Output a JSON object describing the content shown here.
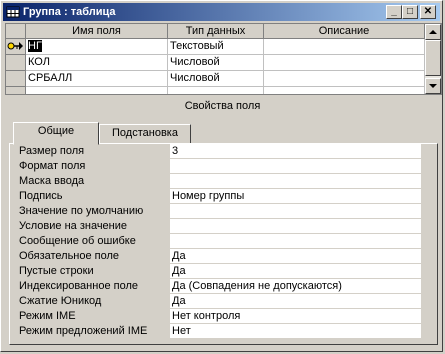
{
  "window": {
    "title": "Группа : таблица",
    "min": "_",
    "max": "□",
    "close": "✕"
  },
  "grid": {
    "columns": [
      "Имя поля",
      "Тип данных",
      "Описание"
    ],
    "rows": [
      {
        "name": "НГ",
        "type": "Текстовый",
        "desc": ""
      },
      {
        "name": "КОЛ",
        "type": "Числовой",
        "desc": ""
      },
      {
        "name": "СРБАЛЛ",
        "type": "Числовой",
        "desc": ""
      },
      {
        "name": "",
        "type": "",
        "desc": ""
      }
    ]
  },
  "props_label": "Свойства поля",
  "tabs": [
    "Общие",
    "Подстановка"
  ],
  "properties": [
    {
      "label": "Размер поля",
      "value": "3"
    },
    {
      "label": "Формат поля",
      "value": ""
    },
    {
      "label": "Маска ввода",
      "value": ""
    },
    {
      "label": "Подпись",
      "value": "Номер группы"
    },
    {
      "label": "Значение по умолчанию",
      "value": ""
    },
    {
      "label": "Условие на значение",
      "value": ""
    },
    {
      "label": "Сообщение об ошибке",
      "value": ""
    },
    {
      "label": "Обязательное поле",
      "value": "Да"
    },
    {
      "label": "Пустые строки",
      "value": "Да"
    },
    {
      "label": "Индексированное поле",
      "value": "Да (Совпадения не допускаются)"
    },
    {
      "label": "Сжатие Юникод",
      "value": "Да"
    },
    {
      "label": "Режим IME",
      "value": "Нет контроля"
    },
    {
      "label": "Режим предложений IME",
      "value": "Нет"
    }
  ]
}
